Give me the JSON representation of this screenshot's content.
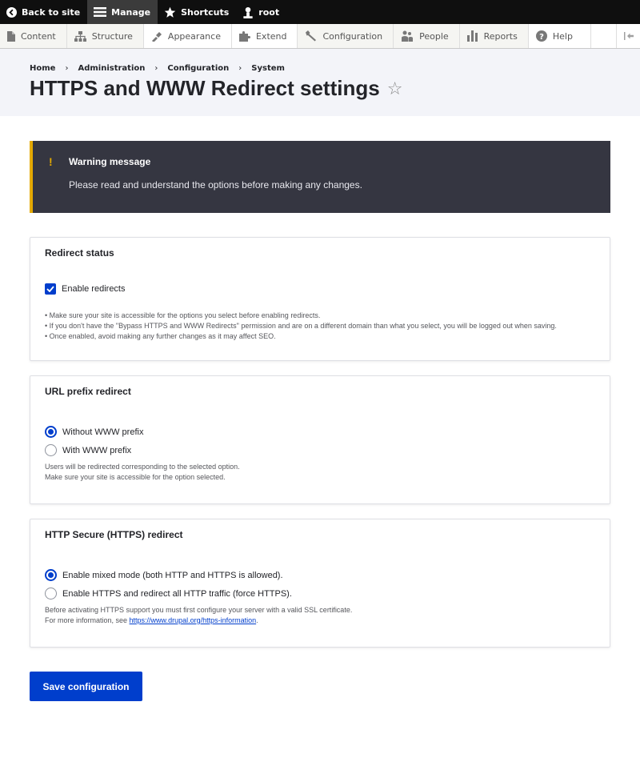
{
  "toolbar": {
    "back_label": "Back to site",
    "manage_label": "Manage",
    "shortcuts_label": "Shortcuts",
    "user_label": "root"
  },
  "tray": {
    "items": [
      {
        "label": "Content",
        "icon": "content-icon"
      },
      {
        "label": "Structure",
        "icon": "structure-icon"
      },
      {
        "label": "Appearance",
        "icon": "appearance-icon"
      },
      {
        "label": "Extend",
        "icon": "extend-icon"
      },
      {
        "label": "Configuration",
        "icon": "wrench-icon"
      },
      {
        "label": "People",
        "icon": "people-icon"
      },
      {
        "label": "Reports",
        "icon": "reports-icon"
      },
      {
        "label": "Help",
        "icon": "help-icon"
      }
    ]
  },
  "breadcrumb": [
    "Home",
    "Administration",
    "Configuration",
    "System"
  ],
  "page": {
    "title": "HTTPS and WWW Redirect settings"
  },
  "warning": {
    "title": "Warning message",
    "text": "Please read and understand the options before making any changes."
  },
  "redirect_status": {
    "legend": "Redirect status",
    "checkbox_label": "Enable redirects",
    "checked": true,
    "desc": [
      "• Make sure your site is accessible for the options you select before enabling redirects.",
      "• If you don't have the \"Bypass HTTPS and WWW Redirects\" permission and are on a different domain than what you select, you will be logged out when saving.",
      "• Once enabled, avoid making any further changes as it may affect SEO."
    ]
  },
  "url_prefix": {
    "legend": "URL prefix redirect",
    "options": [
      "Without WWW prefix",
      "With WWW prefix"
    ],
    "selected": 0,
    "desc": [
      "Users will be redirected corresponding to the selected option.",
      "Make sure your site is accessible for the option selected."
    ]
  },
  "https": {
    "legend": "HTTP Secure (HTTPS) redirect",
    "options": [
      "Enable mixed mode (both HTTP and HTTPS is allowed).",
      "Enable HTTPS and redirect all HTTP traffic (force HTTPS)."
    ],
    "selected": 0,
    "desc_line1": "Before activating HTTPS support you must first configure your server with a valid SSL certificate.",
    "desc_line2_prefix": "For more information, see ",
    "desc_link": "https://www.drupal.org/https-information",
    "desc_line2_suffix": "."
  },
  "save_label": "Save configuration",
  "colors": {
    "accent": "#003ecc",
    "warning_border": "#e4a900",
    "warning_bg": "#353641"
  }
}
